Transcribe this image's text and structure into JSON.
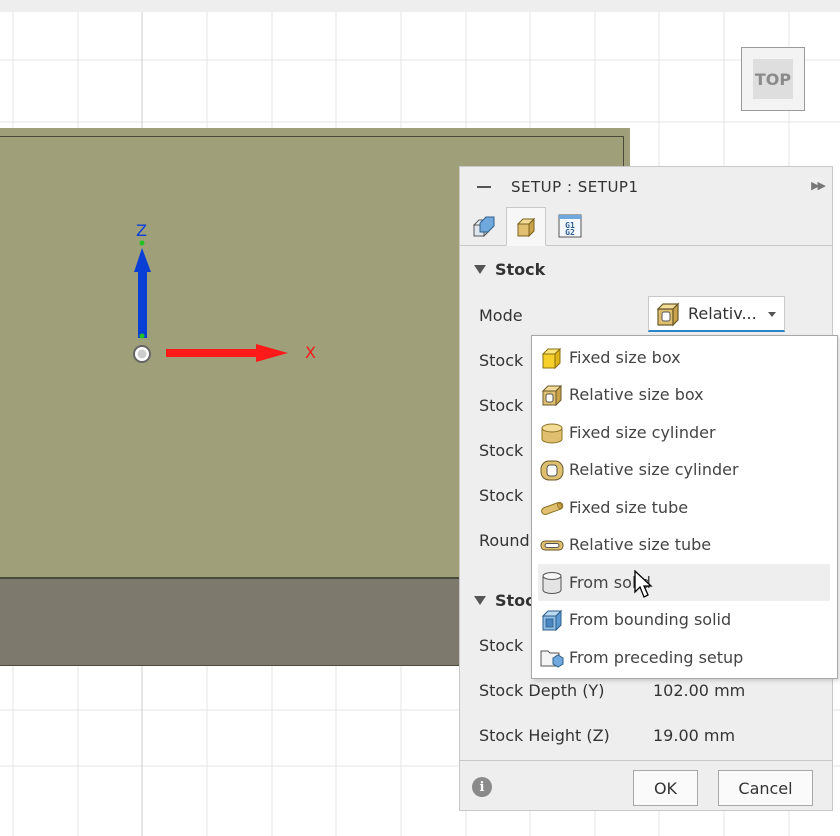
{
  "viewport": {
    "viewcube_label": "TOP",
    "axis_x_label": "X",
    "axis_z_label": "Z",
    "colors": {
      "stock_top": "#9f9f7a",
      "stock_side": "#7d7a6d",
      "x_axis": "#ff1a1a",
      "z_axis": "#0a3fd6"
    }
  },
  "panel": {
    "title": "SETUP : SETUP1",
    "tabs": [
      {
        "icon": "setup-icon",
        "active": false
      },
      {
        "icon": "stock-icon",
        "active": true
      },
      {
        "icon": "post-process-g1g2-icon",
        "active": false
      }
    ],
    "stock_section": {
      "title": "Stock",
      "mode_label": "Mode",
      "mode_value": "Relativ...",
      "hidden_rows": [
        "Stock",
        "Stock",
        "Stock",
        "Stock",
        "Round"
      ]
    },
    "dimensions_section": {
      "title_partial": "Stoc",
      "rows": [
        {
          "label": "Stock",
          "value": ""
        },
        {
          "label": "Stock Depth (Y)",
          "value": "102.00 mm"
        },
        {
          "label": "Stock Height (Z)",
          "value": "19.00 mm"
        }
      ]
    },
    "footer": {
      "ok_label": "OK",
      "cancel_label": "Cancel"
    }
  },
  "dropdown": {
    "items": [
      {
        "label": "Fixed size box",
        "icon": "fixed-box-icon"
      },
      {
        "label": "Relative size box",
        "icon": "relative-box-icon"
      },
      {
        "label": "Fixed size cylinder",
        "icon": "fixed-cylinder-icon"
      },
      {
        "label": "Relative size cylinder",
        "icon": "relative-cylinder-icon"
      },
      {
        "label": "Fixed size tube",
        "icon": "fixed-tube-icon"
      },
      {
        "label": "Relative size tube",
        "icon": "relative-tube-icon"
      },
      {
        "label": "From solid",
        "icon": "from-solid-icon",
        "hovered": true
      },
      {
        "label": "From bounding solid",
        "icon": "bounding-solid-icon"
      },
      {
        "label": "From preceding setup",
        "icon": "preceding-setup-icon"
      }
    ]
  }
}
